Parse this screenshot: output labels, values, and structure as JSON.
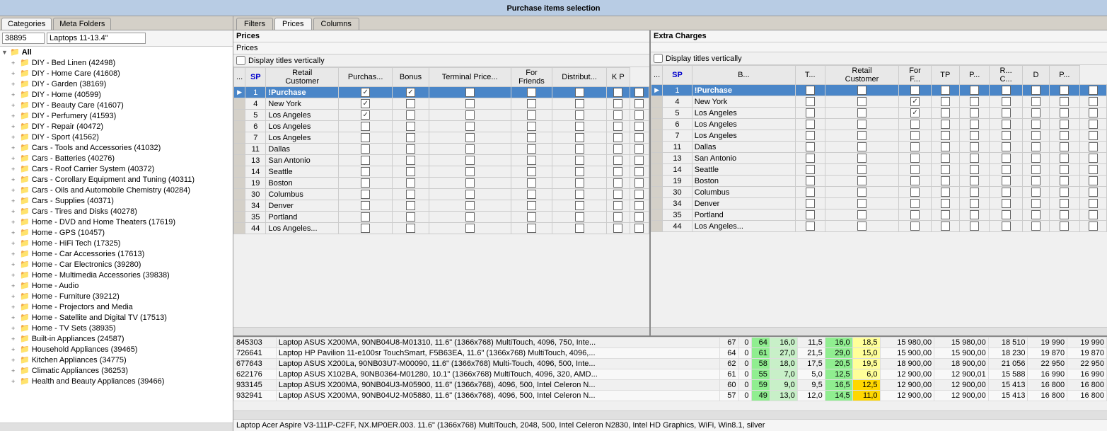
{
  "titleBar": {
    "label": "Purchase items selection"
  },
  "leftPanel": {
    "tabs": [
      {
        "label": "Categories",
        "active": true
      },
      {
        "label": "Meta Folders",
        "active": false
      }
    ],
    "searchId": "38895",
    "searchText": "Laptops 11-13.4\"",
    "treeItems": [
      {
        "id": "all",
        "label": "All",
        "level": 0,
        "bold": true
      },
      {
        "label": "DIY - Bed Linen (42498)",
        "level": 1
      },
      {
        "label": "DIY - Home Care (41608)",
        "level": 1
      },
      {
        "label": "DIY - Garden (38169)",
        "level": 1
      },
      {
        "label": "DIY - Home (40599)",
        "level": 1
      },
      {
        "label": "DIY - Beauty Care (41607)",
        "level": 1
      },
      {
        "label": "DIY - Perfumery (41593)",
        "level": 1
      },
      {
        "label": "DIY - Repair (40472)",
        "level": 1
      },
      {
        "label": "DIY - Sport (41562)",
        "level": 1
      },
      {
        "label": "Cars - Tools and Accessories (41032)",
        "level": 1
      },
      {
        "label": "Cars - Batteries (40276)",
        "level": 1
      },
      {
        "label": "Cars - Roof Carrier System (40372)",
        "level": 1
      },
      {
        "label": "Cars - Corollary Equipment and Tuning (40311)",
        "level": 1
      },
      {
        "label": "Cars - Oils and Automobile Chemistry (40284)",
        "level": 1
      },
      {
        "label": "Cars - Supplies (40371)",
        "level": 1
      },
      {
        "label": "Cars - Tires and Disks (40278)",
        "level": 1
      },
      {
        "label": "Home - DVD and Home Theaters (17619)",
        "level": 1
      },
      {
        "label": "Home - GPS (10457)",
        "level": 1
      },
      {
        "label": "Home - HiFi Tech (17325)",
        "level": 1
      },
      {
        "label": "Home - Car Accessories (17613)",
        "level": 1
      },
      {
        "label": "Home - Car Electronics (39280)",
        "level": 1
      },
      {
        "label": "Home - Multimedia Accessories (39838)",
        "level": 1
      },
      {
        "label": "Home - Audio",
        "level": 1
      },
      {
        "label": "Home - Furniture (39212)",
        "level": 1
      },
      {
        "label": "Home - Projectors and Media",
        "level": 1
      },
      {
        "label": "Home - Satellite and Digital TV (17513)",
        "level": 1
      },
      {
        "label": "Home - TV Sets (38935)",
        "level": 1
      },
      {
        "label": "Built-in Appliances (24587)",
        "level": 1
      },
      {
        "label": "Household Appliances (39465)",
        "level": 1
      },
      {
        "label": "Kitchen Appliances (34775)",
        "level": 1
      },
      {
        "label": "Climatic Appliances (36253)",
        "level": 1
      },
      {
        "label": "Health and Beauty Appliances (39466)",
        "level": 1
      }
    ]
  },
  "filterTabs": [
    {
      "label": "Filters",
      "active": false
    },
    {
      "label": "Prices",
      "active": true
    },
    {
      "label": "Columns",
      "active": false
    }
  ],
  "pricesSection": {
    "header": "Prices",
    "subHeader": "Prices",
    "displayTitlesVertically": "Display titles vertically",
    "columns": [
      "...",
      "SP",
      "Retail Customer",
      "Purchas...",
      "Bonus",
      "Terminal Price...",
      "For Friends",
      "Distribut...",
      "K P"
    ],
    "rows": [
      {
        "marker": "▶",
        "num": 1,
        "name": "!Purchase",
        "selected": true,
        "checks": [
          true,
          true,
          false,
          false,
          false,
          false,
          false
        ]
      },
      {
        "num": 4,
        "name": "New York",
        "checks": [
          true,
          false,
          false,
          false,
          false,
          false,
          false
        ]
      },
      {
        "num": 5,
        "name": "Los Angeles",
        "checks": [
          true,
          false,
          false,
          false,
          false,
          false,
          false
        ]
      },
      {
        "num": 6,
        "name": "Los Angeles",
        "checks": [
          false,
          false,
          false,
          false,
          false,
          false,
          false
        ]
      },
      {
        "num": 7,
        "name": "Los Angeles",
        "checks": [
          false,
          false,
          false,
          false,
          false,
          false,
          false
        ]
      },
      {
        "num": 11,
        "name": "Dallas",
        "checks": [
          false,
          false,
          false,
          false,
          false,
          false,
          false
        ]
      },
      {
        "num": 13,
        "name": "San Antonio",
        "checks": [
          false,
          false,
          false,
          false,
          false,
          false,
          false
        ]
      },
      {
        "num": 14,
        "name": "Seattle",
        "checks": [
          false,
          false,
          false,
          false,
          false,
          false,
          false
        ]
      },
      {
        "num": 19,
        "name": "Boston",
        "checks": [
          false,
          false,
          false,
          false,
          false,
          false,
          false
        ]
      },
      {
        "num": 30,
        "name": "Columbus",
        "checks": [
          false,
          false,
          false,
          false,
          false,
          false,
          false
        ]
      },
      {
        "num": 34,
        "name": "Denver",
        "checks": [
          false,
          false,
          false,
          false,
          false,
          false,
          false
        ]
      },
      {
        "num": 35,
        "name": "Portland",
        "checks": [
          false,
          false,
          false,
          false,
          false,
          false,
          false
        ]
      },
      {
        "num": 44,
        "name": "Los Angeles...",
        "checks": [
          false,
          false,
          false,
          false,
          false,
          false,
          false
        ]
      }
    ]
  },
  "extraCharges": {
    "header": "Extra Charges",
    "displayTitlesVertically": "Display titles vertically",
    "columns": [
      "...",
      "SP",
      "B...",
      "T...",
      "Retail Customer",
      "For F...",
      "TP",
      "P...",
      "R... C...",
      "D",
      "P..."
    ],
    "rows": [
      {
        "marker": "▶",
        "num": 1,
        "name": "!Purchase",
        "selected": true,
        "checks": [
          false,
          false,
          false,
          false,
          false,
          false,
          false,
          false,
          false,
          false
        ]
      },
      {
        "num": 4,
        "name": "New York",
        "checks": [
          false,
          false,
          true,
          false,
          false,
          false,
          false,
          false,
          false,
          false
        ]
      },
      {
        "num": 5,
        "name": "Los Angeles",
        "checks": [
          false,
          false,
          true,
          false,
          false,
          false,
          false,
          false,
          false,
          false
        ]
      },
      {
        "num": 6,
        "name": "Los Angeles",
        "checks": [
          false,
          false,
          false,
          false,
          false,
          false,
          false,
          false,
          false,
          false
        ]
      },
      {
        "num": 7,
        "name": "Los Angeles",
        "checks": [
          false,
          false,
          false,
          false,
          false,
          false,
          false,
          false,
          false,
          false
        ]
      },
      {
        "num": 11,
        "name": "Dallas",
        "checks": [
          false,
          false,
          false,
          false,
          false,
          false,
          false,
          false,
          false,
          false
        ]
      },
      {
        "num": 13,
        "name": "San Antonio",
        "checks": [
          false,
          false,
          false,
          false,
          false,
          false,
          false,
          false,
          false,
          false
        ]
      },
      {
        "num": 14,
        "name": "Seattle",
        "checks": [
          false,
          false,
          false,
          false,
          false,
          false,
          false,
          false,
          false,
          false
        ]
      },
      {
        "num": 19,
        "name": "Boston",
        "checks": [
          false,
          false,
          false,
          false,
          false,
          false,
          false,
          false,
          false,
          false
        ]
      },
      {
        "num": 30,
        "name": "Columbus",
        "checks": [
          false,
          false,
          false,
          false,
          false,
          false,
          false,
          false,
          false,
          false
        ]
      },
      {
        "num": 34,
        "name": "Denver",
        "checks": [
          false,
          false,
          false,
          false,
          false,
          false,
          false,
          false,
          false,
          false
        ]
      },
      {
        "num": 35,
        "name": "Portland",
        "checks": [
          false,
          false,
          false,
          false,
          false,
          false,
          false,
          false,
          false,
          false
        ]
      },
      {
        "num": 44,
        "name": "Los Angeles...",
        "checks": [
          false,
          false,
          false,
          false,
          false,
          false,
          false,
          false,
          false,
          false
        ]
      }
    ]
  },
  "products": [
    {
      "id": "845303",
      "desc": "Laptop ASUS X200MA, 90NB04U8-M01310, 11.6\" (1366x768) MultiTouch, 4096, 750, Inte...",
      "v1": 67,
      "v2": 0,
      "v3": 64,
      "v4": "16,0",
      "v5": "11,5",
      "v6": "16,0",
      "v7": "18,5",
      "v8": "15 980,00",
      "v9": "15 980,00",
      "v10": "18 510",
      "v11": "19 990",
      "v12": "19 990"
    },
    {
      "id": "726641",
      "desc": "Laptop HP Pavilion 11-e100sr TouchSmart, F5B63EA, 11.6\" (1366x768) MultiTouch, 4096,...",
      "v1": 64,
      "v2": 0,
      "v3": 61,
      "v4": "27,0",
      "v5": "21,5",
      "v6": "29,0",
      "v7": "15,0",
      "v8": "15 900,00",
      "v9": "15 900,00",
      "v10": "18 230",
      "v11": "19 870",
      "v12": "19 870"
    },
    {
      "id": "677643",
      "desc": "Laptop ASUS X200La, 90NB03U7-M00090, 11.6\" (1366x768) Multi-Touch, 4096, 500, Inte...",
      "v1": 62,
      "v2": 0,
      "v3": 58,
      "v4": "18,0",
      "v5": "17,5",
      "v6": "20,5",
      "v7": "19,5",
      "v8": "18 900,00",
      "v9": "18 900,00",
      "v10": "21 056",
      "v11": "22 950",
      "v12": "22 950"
    },
    {
      "id": "622176",
      "desc": "Laptop ASUS X102BA, 90NB0364-M01280, 10.1\" (1366x768) MultiTouch, 4096, 320, AMD...",
      "v1": 61,
      "v2": 0,
      "v3": 55,
      "v4": "7,0",
      "v5": "5,0",
      "v6": "12,5",
      "v7": "6,0",
      "v8": "12 900,00",
      "v9": "12 900,01",
      "v10": "15 588",
      "v11": "16 990",
      "v12": "16 990"
    },
    {
      "id": "933145",
      "desc": "Laptop ASUS X200MA, 90NB04U3-M05900, 11.6\" (1366x768), 4096, 500, Intel Celeron N...",
      "v1": 60,
      "v2": 0,
      "v3": 59,
      "v4": "9,0",
      "v5": "9,5",
      "v6": "16,5",
      "v7": "12,5",
      "v8": "12 900,00",
      "v9": "12 900,00",
      "v10": "15 413",
      "v11": "16 800",
      "v12": "16 800"
    },
    {
      "id": "932941",
      "desc": "Laptop ASUS X200MA, 90NB04U2-M05880, 11.6\" (1366x768), 4096, 500, Intel Celeron N...",
      "v1": 57,
      "v2": 0,
      "v3": 49,
      "v4": "13,0",
      "v5": "12,0",
      "v6": "14,5",
      "v7": "11,0",
      "v8": "12 900,00",
      "v9": "12 900,00",
      "v10": "15 413",
      "v11": "16 800",
      "v12": "16 800"
    }
  ],
  "statusBar": "Laptop Acer Aspire V3-111P-C2FF, NX.MP0ER.003. 11.6\" (1366x768) MultiTouch, 2048, 500, Intel Celeron N2830, Intel HD Graphics, WiFi, Win8.1, silver"
}
